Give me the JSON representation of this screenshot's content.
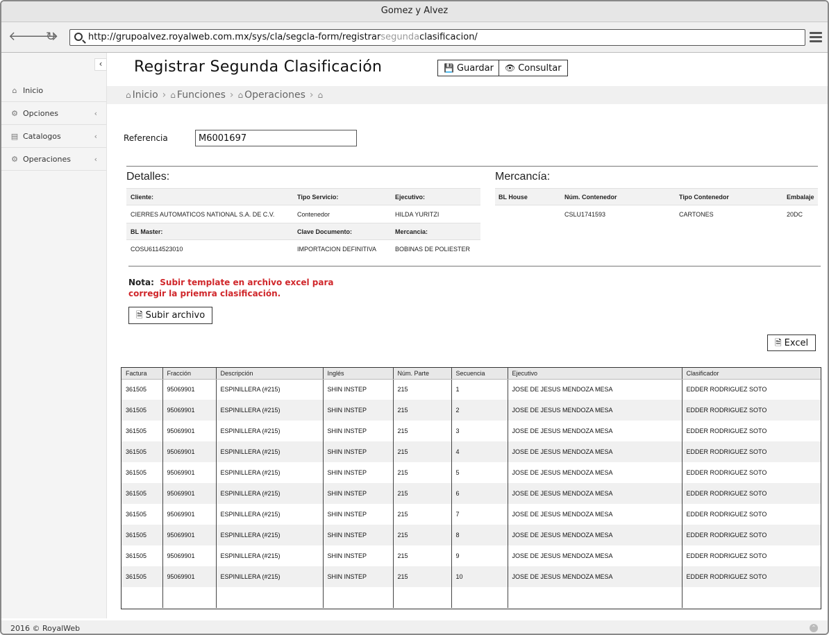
{
  "window": {
    "title": "Gomez y Alvez"
  },
  "browser": {
    "url_prefix": "http://grupoalvez.royalweb.com.mx/sys/cla/segcla-form/registrar",
    "url_highlight": "segunda",
    "url_suffix": "clasificacion/"
  },
  "sidebar": {
    "collapse_icon": "‹",
    "items": [
      {
        "label": "Inicio",
        "icon": "home-icon"
      },
      {
        "label": "Opciones",
        "icon": "cogs-icon"
      },
      {
        "label": "Catalogos",
        "icon": "book-icon"
      },
      {
        "label": "Operaciones",
        "icon": "gear-icon"
      }
    ]
  },
  "header": {
    "title": "Registrar Segunda Clasificación",
    "save_label": "Guardar",
    "consult_label": "Consultar"
  },
  "breadcrumb": [
    "Inicio",
    "Funciones",
    "Operaciones"
  ],
  "form": {
    "ref_label": "Referencia",
    "ref_value": "M6001697"
  },
  "detalles": {
    "title": "Detalles:",
    "cliente_label": "Cliente:",
    "cliente": "CIERRES AUTOMATICOS NATIONAL S.A. DE C.V.",
    "tipo_servicio_label": "Tipo Servicio:",
    "tipo_servicio": "Contenedor",
    "ejecutivo_label": "Ejecutivo:",
    "ejecutivo": "HILDA YURITZI",
    "bl_master_label": "BL Master:",
    "bl_master": "COSU6114523010",
    "clave_label": "Clave Documento:",
    "clave": "IMPORTACION DEFINITIVA",
    "mercancia_label": "Mercancia:",
    "mercancia": "BOBINAS DE POLIESTER"
  },
  "mercancia": {
    "title": "Mercancía:",
    "bl_house_label": "BL House",
    "num_contenedor_label": "Núm. Contenedor",
    "tipo_contenedor_label": "Tipo Contenedor",
    "embalaje_label": "Embalaje",
    "num_contenedor": "CSLU1741593",
    "tipo_contenedor": "CARTONES",
    "embalaje": "20DC"
  },
  "nota": {
    "label": "Nota:",
    "text": "Subir template en archivo excel para corregir la priemra clasificación."
  },
  "upload_label": "Subir archivo",
  "excel_label": "Excel",
  "table": {
    "columns": [
      "Factura",
      "Fracción",
      "Descripción",
      "Inglés",
      "Núm. Parte",
      "Secuencia",
      "Ejecutivo",
      "Clasificador"
    ],
    "rows": [
      [
        "361505",
        "95069901",
        "ESPINILLERA (#215)",
        "SHIN INSTEP",
        "215",
        "1",
        "JOSE DE JESUS MENDOZA MESA",
        "EDDER RODRIGUEZ SOTO"
      ],
      [
        "361505",
        "95069901",
        "ESPINILLERA (#215)",
        "SHIN INSTEP",
        "215",
        "2",
        "JOSE DE JESUS MENDOZA MESA",
        "EDDER RODRIGUEZ SOTO"
      ],
      [
        "361505",
        "95069901",
        "ESPINILLERA (#215)",
        "SHIN INSTEP",
        "215",
        "3",
        "JOSE DE JESUS MENDOZA MESA",
        "EDDER RODRIGUEZ SOTO"
      ],
      [
        "361505",
        "95069901",
        "ESPINILLERA (#215)",
        "SHIN INSTEP",
        "215",
        "4",
        "JOSE DE JESUS MENDOZA MESA",
        "EDDER RODRIGUEZ SOTO"
      ],
      [
        "361505",
        "95069901",
        "ESPINILLERA (#215)",
        "SHIN INSTEP",
        "215",
        "5",
        "JOSE DE JESUS MENDOZA MESA",
        "EDDER RODRIGUEZ SOTO"
      ],
      [
        "361505",
        "95069901",
        "ESPINILLERA (#215)",
        "SHIN INSTEP",
        "215",
        "6",
        "JOSE DE JESUS MENDOZA MESA",
        "EDDER RODRIGUEZ SOTO"
      ],
      [
        "361505",
        "95069901",
        "ESPINILLERA (#215)",
        "SHIN INSTEP",
        "215",
        "7",
        "JOSE DE JESUS MENDOZA MESA",
        "EDDER RODRIGUEZ SOTO"
      ],
      [
        "361505",
        "95069901",
        "ESPINILLERA (#215)",
        "SHIN INSTEP",
        "215",
        "8",
        "JOSE DE JESUS MENDOZA MESA",
        "EDDER RODRIGUEZ SOTO"
      ],
      [
        "361505",
        "95069901",
        "ESPINILLERA (#215)",
        "SHIN INSTEP",
        "215",
        "9",
        "JOSE DE JESUS MENDOZA MESA",
        "EDDER RODRIGUEZ SOTO"
      ],
      [
        "361505",
        "95069901",
        "ESPINILLERA (#215)",
        "SHIN INSTEP",
        "215",
        "10",
        "JOSE DE JESUS MENDOZA MESA",
        "EDDER RODRIGUEZ SOTO"
      ],
      [
        "",
        "",
        "",
        "",
        "",
        "",
        "",
        ""
      ]
    ]
  },
  "footer": {
    "text": "2016 © RoyalWeb"
  }
}
